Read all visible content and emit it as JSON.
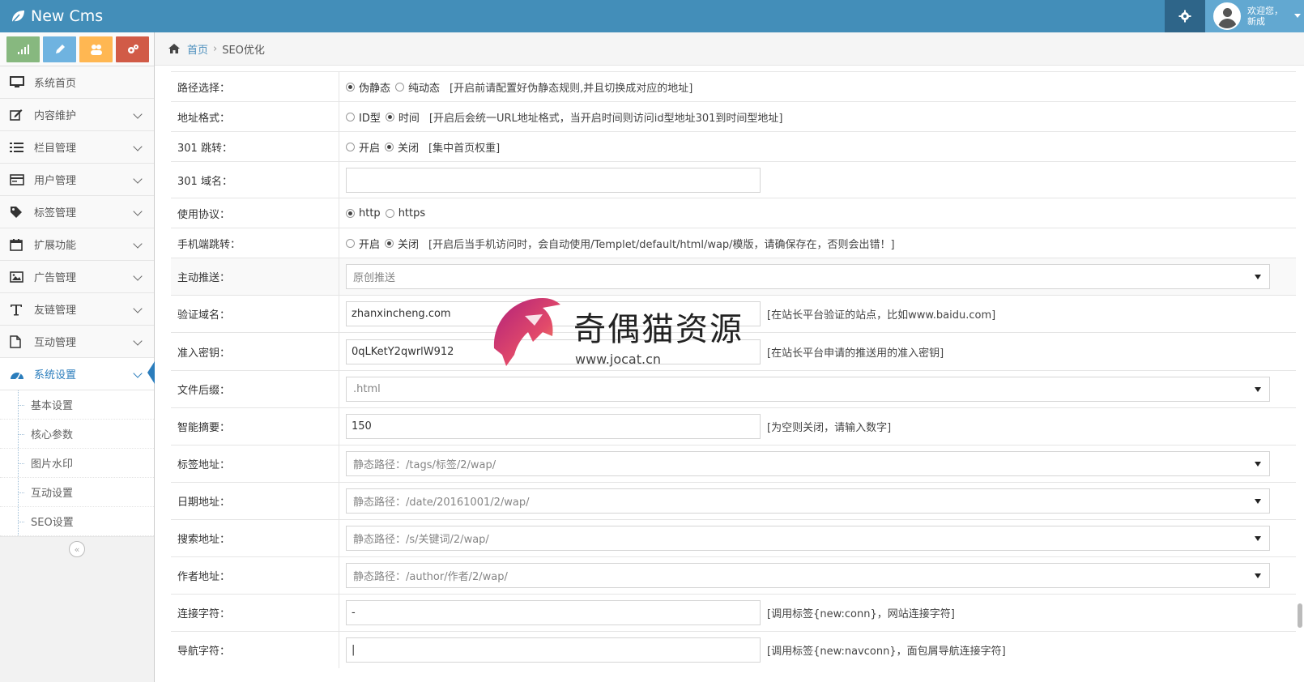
{
  "app": {
    "brand": "New Cms",
    "welcome_line1": "欢迎您，",
    "welcome_line2": "新成"
  },
  "shortcuts": [
    {
      "icon": "signal-icon",
      "color": "#87b87f"
    },
    {
      "icon": "pencil-icon",
      "color": "#6fb3e0"
    },
    {
      "icon": "users-icon",
      "color": "#ffb752"
    },
    {
      "icon": "cogs-icon",
      "color": "#d15b47"
    }
  ],
  "sidebar": {
    "items": [
      {
        "label": "系统首页",
        "icon": "desktop-icon",
        "has_arrow": false
      },
      {
        "label": "内容维护",
        "icon": "edit-icon",
        "has_arrow": true
      },
      {
        "label": "栏目管理",
        "icon": "list-icon",
        "has_arrow": true
      },
      {
        "label": "用户管理",
        "icon": "card-icon",
        "has_arrow": true
      },
      {
        "label": "标签管理",
        "icon": "tag-icon",
        "has_arrow": true
      },
      {
        "label": "扩展功能",
        "icon": "calendar-icon",
        "has_arrow": true
      },
      {
        "label": "广告管理",
        "icon": "picture-icon",
        "has_arrow": true
      },
      {
        "label": "友链管理",
        "icon": "text-icon",
        "has_arrow": true
      },
      {
        "label": "互动管理",
        "icon": "file-icon",
        "has_arrow": true
      },
      {
        "label": "系统设置",
        "icon": "dashboard-icon",
        "has_arrow": true,
        "active": true
      }
    ],
    "submenu": [
      "基本设置",
      "核心参数",
      "图片水印",
      "互动设置",
      "SEO设置"
    ],
    "collapse_glyph": "«"
  },
  "breadcrumb": {
    "home": "首页",
    "separator": "›",
    "current": "SEO优化"
  },
  "form": {
    "path_select": {
      "label": "路径选择：",
      "opt1": "伪静态",
      "opt2": "纯动态",
      "hint": "[开启前请配置好伪静态规则,并且切换成对应的地址]",
      "selected": 1
    },
    "url_format": {
      "label": "地址格式：",
      "opt1": "ID型",
      "opt2": "时间",
      "hint": "[开启后会统一URL地址格式，当开启时间则访问id型地址301到时间型地址]",
      "selected": 2
    },
    "redirect_301": {
      "label": "301 跳转：",
      "opt1": "开启",
      "opt2": "关闭",
      "hint": "[集中首页权重]",
      "selected": 2
    },
    "domain_301": {
      "label": "301 域名：",
      "value": ""
    },
    "protocol": {
      "label": "使用协议：",
      "opt1": "http",
      "opt2": "https",
      "selected": 1
    },
    "mobile_redirect": {
      "label": "手机端跳转：",
      "opt1": "开启",
      "opt2": "关闭",
      "hint": "[开启后当手机访问时，会自动使用/Templet/default/html/wap/模版，请确保存在，否则会出错！]",
      "selected": 2
    },
    "push": {
      "label": "主动推送：",
      "value": "原创推送"
    },
    "verify_domain": {
      "label": "验证域名：",
      "value": "zhanxincheng.com",
      "hint": "[在站长平台验证的站点，比如www.baidu.com]"
    },
    "access_key": {
      "label": "准入密钥：",
      "value": "0qLKetY2qwrlW912",
      "hint": "[在站长平台申请的推送用的准入密钥]"
    },
    "file_suffix": {
      "label": "文件后缀：",
      "value": ".html"
    },
    "smart_summary": {
      "label": "智能摘要：",
      "value": "150",
      "hint": "[为空则关闭，请输入数字]"
    },
    "tag_url": {
      "label": "标签地址：",
      "value": "静态路径：/tags/标签/2/wap/"
    },
    "date_url": {
      "label": "日期地址：",
      "value": "静态路径：/date/20161001/2/wap/"
    },
    "search_url": {
      "label": "搜索地址：",
      "value": "静态路径：/s/关键词/2/wap/"
    },
    "author_url": {
      "label": "作者地址：",
      "value": "静态路径：/author/作者/2/wap/"
    },
    "conn_char": {
      "label": "连接字符：",
      "value": "-",
      "hint": "[调用标签{new:conn}，网站连接字符]"
    },
    "nav_char": {
      "label": "导航字符：",
      "value": "|",
      "hint": "[调用标签{new:navconn}，面包屑导航连接字符]"
    }
  },
  "watermark": {
    "title": "奇偶猫资源",
    "url": "www.jocat.cn"
  },
  "colors": {
    "navbar": "#438eb9",
    "active_menu": "#2b7dbc",
    "link": "#4c8fbd"
  }
}
